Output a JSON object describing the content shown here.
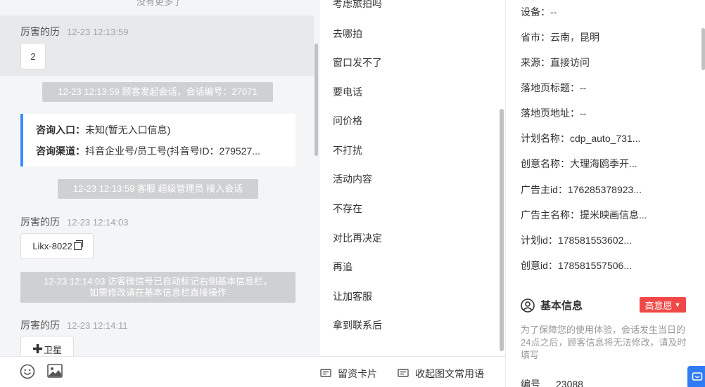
{
  "chat": {
    "no_more": "没有更多了",
    "blocks": [
      {
        "sender": "厉害的历",
        "time": "12-23 12:13:59",
        "content": "2"
      },
      {
        "sender": "厉害的历",
        "time": "12-23 12:14:03",
        "content": "Likx-8022"
      },
      {
        "sender": "厉害的历",
        "time": "12-23 12:14:11",
        "content": "卫星"
      }
    ],
    "system": {
      "session_start": "12-23 12:13:59 顾客发起会话，会话编号：27071",
      "agent_join": "12-23 12:13:59 客服 超级管理员 接入会话",
      "wechat_note_line1": "12-23 12:14:03 访客微信号已自动标记右侧基本信息栏，",
      "wechat_note_line2": "如需修改请在基本信息栏直接操作"
    },
    "info_card": {
      "entry_label": "咨询入口：",
      "entry_value": "未知(暂无入口信息)",
      "channel_label": "咨询渠道：",
      "channel_value": "抖音企业号/员工号(抖音号ID：279527..."
    }
  },
  "quick_replies": {
    "items": [
      "考虑旅拍吗",
      "去哪拍",
      "窗口发不了",
      "要电话",
      "问价格",
      "不打扰",
      "活动内容",
      "不存在",
      "对比再决定",
      "再追",
      "让加客服",
      "拿到联系后"
    ]
  },
  "toolbar": {
    "emoji_icon": "smile-icon",
    "image_icon": "image-icon",
    "lead_card": "留资卡片",
    "collapse_common": "收起图文常用语"
  },
  "details": {
    "fields": [
      "设备：--",
      "省市：云南，昆明",
      "来源：直接访问",
      "落地页标题：--",
      "落地页地址：--",
      "计划名称：cdp_auto_731...",
      "创意名称：大理海鸥季开...",
      "广告主id：176285378923...",
      "广告主名称：提米映画信息...",
      "计划id：178581553602...",
      "创意id：178581557506..."
    ],
    "basic_info_title": "基本信息",
    "intent_badge": "高意愿",
    "notice": "为了保障您的使用体验，会话发生当日的24点之后，顾客信息将无法修改，请及时填写",
    "number_label": "编号",
    "number_value": "23088"
  },
  "colors": {
    "accent": "#3d8bff",
    "badge": "#f04848",
    "system_msg": "#cfd0d2"
  }
}
